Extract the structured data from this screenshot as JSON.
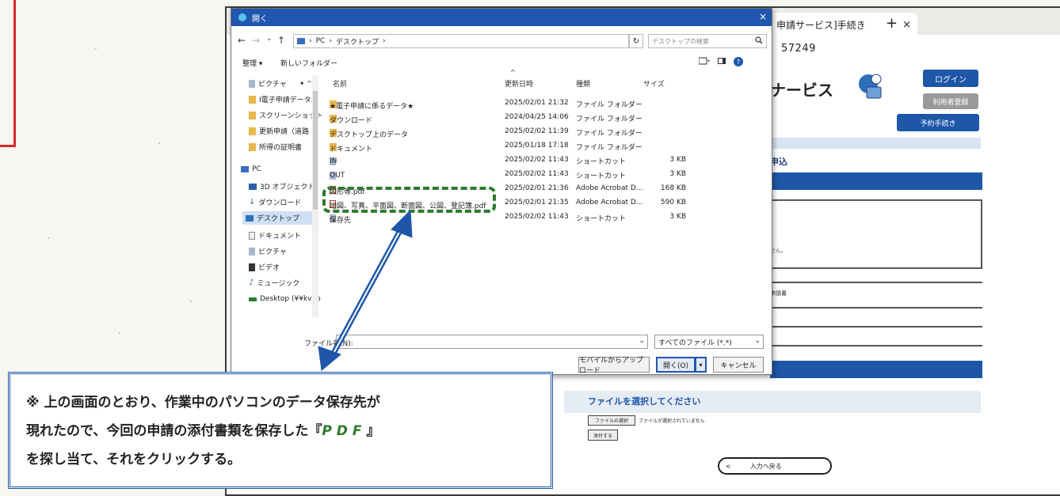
{
  "browser": {
    "tab_title": "申請サービス]手続き",
    "tab_close": "×",
    "new_tab": "+",
    "url_id": "57249"
  },
  "site": {
    "title": "ナービス",
    "login_button": "ログイン",
    "register_button": "利用者登録",
    "reserve_button": "予約手続き",
    "section_heading": "申込",
    "box_text": "せん。",
    "small_label": "申請書",
    "file_section_title": "ファイルを選択してください",
    "choose_file_button": "ファイルの選択",
    "no_file_text": "ファイルが選択されていません",
    "attach_button": "添付する",
    "next_button_caret": "<",
    "next_button": "入力へ戻る"
  },
  "dialog": {
    "title": "開く",
    "close": "×",
    "nav_back": "←",
    "nav_forward": "→",
    "nav_recent": "⌄",
    "nav_up": "↑",
    "breadcrumb": [
      "PC",
      "›",
      "デスクトップ",
      "›"
    ],
    "refresh": "↻",
    "search_placeholder": "デスクトップの検索",
    "organize": "整理 ▾",
    "new_folder": "新しいフォルダー",
    "nav_items": [
      {
        "label": "ピクチャ",
        "icon": "pictures-icon"
      },
      {
        "label": "I電子申請データ:",
        "icon": "folder-icon"
      },
      {
        "label": "スクリーンショット",
        "icon": "folder-icon"
      },
      {
        "label": "更新申請（道路",
        "icon": "folder-icon"
      },
      {
        "label": "所得の証明書",
        "icon": "folder-icon"
      },
      {
        "label": "PC",
        "icon": "pc-icon"
      },
      {
        "label": "3D オブジェクト",
        "icon": "3d-objects-icon"
      },
      {
        "label": "ダウンロード",
        "icon": "download-icon"
      },
      {
        "label": "デスクトップ",
        "icon": "desktop-icon"
      },
      {
        "label": "ドキュメント",
        "icon": "documents-icon"
      },
      {
        "label": "ピクチャ",
        "icon": "pictures-icon"
      },
      {
        "label": "ビデオ",
        "icon": "video-icon"
      },
      {
        "label": "ミュージック",
        "icon": "music-icon"
      },
      {
        "label": "Desktop (¥¥kvab",
        "icon": "network-drive-icon"
      }
    ],
    "columns": {
      "name": "名前",
      "date": "更新日時",
      "type": "種類",
      "size": "サイズ"
    },
    "files": [
      {
        "name": "★電子申請に係るデータ★",
        "date": "2025/02/01 21:32",
        "type": "ファイル フォルダー",
        "size": "",
        "icon": "folder"
      },
      {
        "name": "ダウンロード",
        "date": "2024/04/25 14:06",
        "type": "ファイル フォルダー",
        "size": "",
        "icon": "folder"
      },
      {
        "name": "デスクトップ上のデータ",
        "date": "2025/02/02 11:39",
        "type": "ファイル フォルダー",
        "size": "",
        "icon": "folder"
      },
      {
        "name": "ドキュメント",
        "date": "2025/01/18 17:18",
        "type": "ファイル フォルダー",
        "size": "",
        "icon": "folder"
      },
      {
        "name": "IN",
        "date": "2025/02/02 11:43",
        "type": "ショートカット",
        "size": "3 KB",
        "icon": "shortcut"
      },
      {
        "name": "OUT",
        "date": "2025/02/02 11:43",
        "type": "ショートカット",
        "size": "3 KB",
        "icon": "shortcut"
      },
      {
        "name": "図形等.pdf",
        "date": "2025/02/01 21:36",
        "type": "Adobe Acrobat D...",
        "size": "168 KB",
        "icon": "pdf"
      },
      {
        "name": "地図、写真、平面図、断面図、公図、登記簿.pdf",
        "date": "2025/02/01 21:35",
        "type": "Adobe Acrobat D...",
        "size": "590 KB",
        "icon": "pdf"
      },
      {
        "name": "保存先",
        "date": "2025/02/02 11:43",
        "type": "ショートカット",
        "size": "3 KB",
        "icon": "shortcut"
      }
    ],
    "filename_label": "ファイル名(N):",
    "filename_caret": "⌄",
    "file_filter": "すべてのファイル (*.*)",
    "filter_caret": "⌄",
    "upload_button": "モバイルからアップロード",
    "open_button": "開く(O)",
    "open_arrow": "▾",
    "cancel_button": "キャンセル"
  },
  "callout": {
    "line1": "※ 上の画面のとおり、作業中のパソコンのデータ保存先が",
    "line2_before": "現れたので、今回の申請の添付書類を保存した『",
    "line2_pdf": "PDF",
    "line2_after": "』",
    "line3": "を探し当て、それをクリックする。"
  },
  "colors": {
    "accent_blue": "#1e56a8",
    "highlight_green": "#2f7a2f",
    "frame_red": "#d22a2a"
  }
}
